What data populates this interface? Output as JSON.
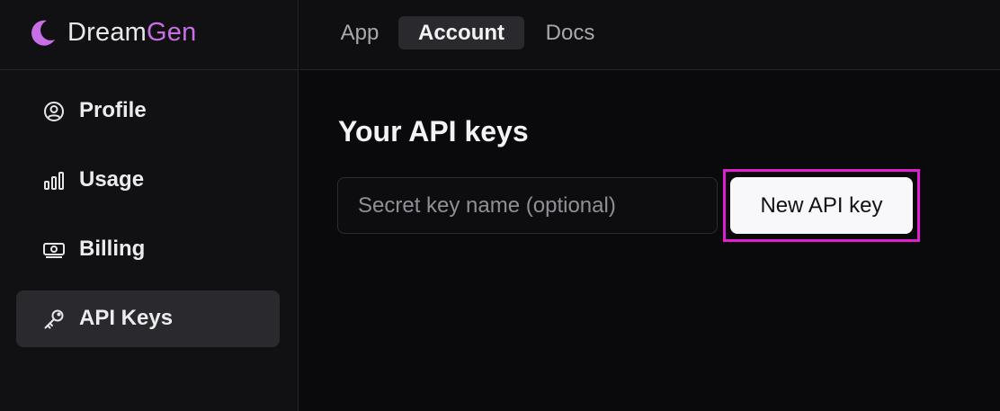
{
  "brand": {
    "name_part1": "Dream",
    "name_part2": "Gen",
    "accent_color": "#c86ee6",
    "icon": "moon-icon"
  },
  "top_nav": {
    "tabs": [
      {
        "label": "App",
        "active": false
      },
      {
        "label": "Account",
        "active": true
      },
      {
        "label": "Docs",
        "active": false
      }
    ]
  },
  "sidebar": {
    "items": [
      {
        "label": "Profile",
        "icon": "user-circle-icon",
        "active": false
      },
      {
        "label": "Usage",
        "icon": "bar-chart-icon",
        "active": false
      },
      {
        "label": "Billing",
        "icon": "banknote-icon",
        "active": false
      },
      {
        "label": "API Keys",
        "icon": "key-icon",
        "active": true
      }
    ]
  },
  "main": {
    "title": "Your API keys",
    "key_name_input": {
      "value": "",
      "placeholder": "Secret key name (optional)"
    },
    "new_key_button_label": "New API key"
  },
  "colors": {
    "highlight": "#e020d0",
    "background": "#0a0a0c",
    "sidebar_background": "#111113"
  }
}
